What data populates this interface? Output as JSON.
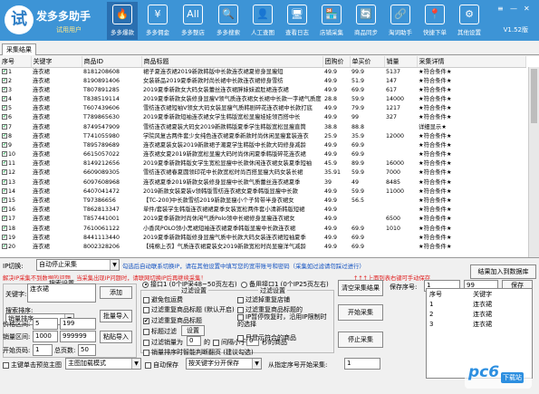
{
  "app": {
    "logo_char": "试",
    "name": "发多多助手",
    "subtitle": "试用用户",
    "version": "V1.52版"
  },
  "nav": [
    {
      "icon": "🔥",
      "label": "多多爆款"
    },
    {
      "icon": "¥",
      "label": "多多佣金"
    },
    {
      "icon": "All",
      "label": "多多整店"
    },
    {
      "icon": "🔍",
      "label": "多多搜索"
    },
    {
      "icon": "👤",
      "label": "人工查图"
    },
    {
      "icon": "🖥",
      "label": "查看日志"
    },
    {
      "icon": "🏪",
      "label": "店铺采集"
    },
    {
      "icon": "🔄",
      "label": "商品同步"
    },
    {
      "icon": "🔗",
      "label": "淘词助手"
    },
    {
      "icon": "📍",
      "label": "快捷下单"
    },
    {
      "icon": "⚙",
      "label": "其他设置"
    }
  ],
  "window_controls": {
    "menu": "≡",
    "minimize": "—",
    "close": "✕"
  },
  "tab": "采集结果",
  "table": {
    "headers": [
      "序号",
      "关键字",
      "商品ID",
      "商品标题",
      "团购价",
      "单买价",
      "销量",
      "采集详情"
    ],
    "rows": [
      [
        "1",
        "连衣裙",
        "8181208608",
        "裙子夏连衣裙2019新款韩版中长款连衣裙夏修身显瘦短",
        "49.9",
        "99.9",
        "5137",
        "★符合条件★"
      ],
      [
        "2",
        "连衣裙",
        "8190891406",
        "女装新品2019夏季新款时尚长裙中长款连衣裙修身雪纺",
        "49.9",
        "51.9",
        "147",
        "★符合条件★"
      ],
      [
        "3",
        "连衣裙",
        "T807891285",
        "2019夏季新款女大码女装蕾丝连衣裙胖妹妹遮肚裙连衣裙",
        "49.9",
        "69.9",
        "617",
        "★符合条件★"
      ],
      [
        "4",
        "连衣裙",
        "T838519114",
        "2019夏季新款女装修身显瘦V领气质连衣裙女长裙中长款一字裙气质度",
        "28.8",
        "59.9",
        "14000",
        "★符合条件★"
      ],
      [
        "5",
        "连衣裙",
        "T607439606",
        "雪纺连衣裙短袖V领女大码女装显瘦气质韩剧碎花连衣裙中长款打底",
        "49.9",
        "79.9",
        "1217",
        "★符合条件★"
      ],
      [
        "6",
        "连衣裙",
        "T789865630",
        "2019夏季新款短袖连衣裙女学生韩版宽松显瘦娃娃领百搭中长",
        "49.9",
        "99",
        "327",
        "★符合条件★"
      ],
      [
        "7",
        "连衣裙",
        "8749547909",
        "雪纺连衣裙夏装大码女2019新款韩版夏季学生韩版宽松显瘦直筒",
        "38.8",
        "88.8",
        "",
        "详细显示★"
      ],
      [
        "8",
        "连衣裙",
        "T741055980",
        "学院风复古两件套少女纯色连衣裙夏季新款时尚休闲显瘦套装连衣",
        "25.9",
        "35.9",
        "12000",
        "★符合条件★"
      ],
      [
        "9",
        "连衣裙",
        "T895789689",
        "连衣裙夏装女装2019新款裙子潮夏学生韩版中长款大码修身减龄",
        "49.9",
        "69.9",
        "",
        "★符合条件★"
      ],
      [
        "10",
        "连衣裙",
        "6615057022",
        "连衣裙女夏2019新款宽松显瘦大码时尚休闲夏季韩版碎花连衣裙",
        "49.9",
        "69.9",
        "",
        "★符合条件★"
      ],
      [
        "11",
        "连衣裙",
        "8149212656",
        "2019夏季新款韩版女学生宽松显瘦中长款休闲连衣裙女装夏季短袖",
        "45.9",
        "89.9",
        "16000",
        "★符合条件★"
      ],
      [
        "12",
        "连衣裙",
        "6609089305",
        "雪纺连衣裙春夏圆领印花中长款宽松时尚百搭显瘦大码女装长裙",
        "35.91",
        "59.9",
        "7000",
        "★符合条件★"
      ],
      [
        "13",
        "连衣裙",
        "6097608968",
        "连衣裙夏季2019新款女装修身显瘦中长款气质蕾丝连衣裙夏季",
        "39",
        "49",
        "8485",
        "★符合条件★"
      ],
      [
        "14",
        "连衣裙",
        "6407041472",
        "2019新款女装夏装v领韩版雪纺连衣裙女夏季韩版显瘦中长款",
        "49.9",
        "59.9",
        "11000",
        "★符合条件★"
      ],
      [
        "15",
        "连衣裙",
        "T97386656",
        "【TC-200]中长款雪纺2019新款显瘦小个子背带半身衣裙女",
        "49.9",
        "56.5",
        "",
        "★符合条件★"
      ],
      [
        "16",
        "连衣裙",
        "T862813347",
        "单件/套装学生韩版连衣裙裙夏季女装宽松两件套小清新韩版短裙",
        "49.9",
        "",
        "",
        "★符合条件★"
      ],
      [
        "17",
        "连衣裙",
        "T857441001",
        "2019夏季新款时尚休闲气质Polo领中长裙修身显瘦连衣裙女",
        "49.9",
        "",
        "6500",
        "★符合条件★"
      ],
      [
        "18",
        "连衣裙",
        "7610061122",
        "小香风POLO领小黑裙短袖连衣裙夏季韩版显瘦中长款连衣裙",
        "49.9",
        "69.9",
        "1010",
        "★符合条件★"
      ],
      [
        "19",
        "连衣裙",
        "8441113440",
        "2019夏季新款韩版修身显瘦气质中长款大码女装连衣裙短袖夏季",
        "49.9",
        "69.9",
        "",
        "★符合条件★"
      ],
      [
        "20",
        "连衣裙",
        "8002328206",
        "【纯棉上衣】气质连衣裙夏装女2019新款宽松时尚显瘦洋气减龄",
        "49.9",
        "69.9",
        "",
        "★符合条件★"
      ]
    ]
  },
  "ip": {
    "label": "IP切换:",
    "mode": "自动停止采集",
    "note_blue": "勾选后自动联系切换IP，请在其他设置中填写您的宽带账号和密码（采集如过滤请勿踩过进行）",
    "note_red": "解决IP采集不到数据的问题，当采集出现IP问题时，请联网切换IP后再继续采集！",
    "link_red": "↑↑↑上面列表右键可手动保存",
    "export_button": "结果加入到数据库"
  },
  "search": {
    "group_title": "搜索设置",
    "keyword_label": "关键字:",
    "keyword_value": "连衣裙",
    "add_button": "添加",
    "sort_label": "搜索排序:",
    "sort_value": "销量排序",
    "batch_import_button": "批量导入",
    "price_label": "价格区间:",
    "price_min": "5",
    "price_max": "199",
    "sales_label": "销量区间:",
    "sales_min": "1000",
    "sales_max": "999999",
    "paste_button": "粘贴导入",
    "page_label": "开始页码:",
    "page_value": "1",
    "total_label": "总页数:",
    "total_value": "50"
  },
  "filter": {
    "api_option_1": "接口1 (0个IP采48~50页左右)",
    "api_option_2": "备用接口1 (0个IP25页左右)",
    "group_title": "过滤设置",
    "group_title_2": "过滤设置",
    "opt_new": "避免包运费",
    "opt_dup": "过滤重复商品标题 (默认开启)",
    "opt_shop": "过滤重复商品标题",
    "opt_title": "标题过滤",
    "set_button": "设置",
    "opt_sales_cb": "过滤销量为",
    "sales_value": "0",
    "sales_unit": "的",
    "opt_interval": "间隔小于",
    "interval_value": "0",
    "interval_unit": "秒的商品",
    "opt_hist": "过滤重复商品标题的",
    "opt_ip_recall": "IP暂停恢复时，沿用IP限制时的选择",
    "opt_all_shop": "只显示符合的商品",
    "opt_smart": "销量排序时智能判断翻页 (建议勾选)",
    "opt_vip": "过滤掉重复店铺"
  },
  "bottom": {
    "autosave_label": "主键单击预览主图",
    "preview_mode": "主图加载模式",
    "autosave_cb": "自动保存",
    "sort_mode": "按关键字分开保存",
    "interval_label": "从指定序号开始采集:",
    "interval_value": "1"
  },
  "actions": {
    "clear_button": "清空采集结果",
    "start_button": "开始采集",
    "stop_button": "停止采集",
    "save_seq_label": "保存序号:",
    "save_from": "1",
    "save_to": "99",
    "save_button": "保存"
  },
  "result_list": {
    "headers": [
      "序号",
      "关键字"
    ],
    "rows": [
      [
        "1",
        "连衣裙"
      ],
      [
        "2",
        "连衣裙"
      ],
      [
        "3",
        "连衣裙"
      ]
    ]
  },
  "watermark": {
    "brand": "pc6",
    "sub": "下载站"
  }
}
